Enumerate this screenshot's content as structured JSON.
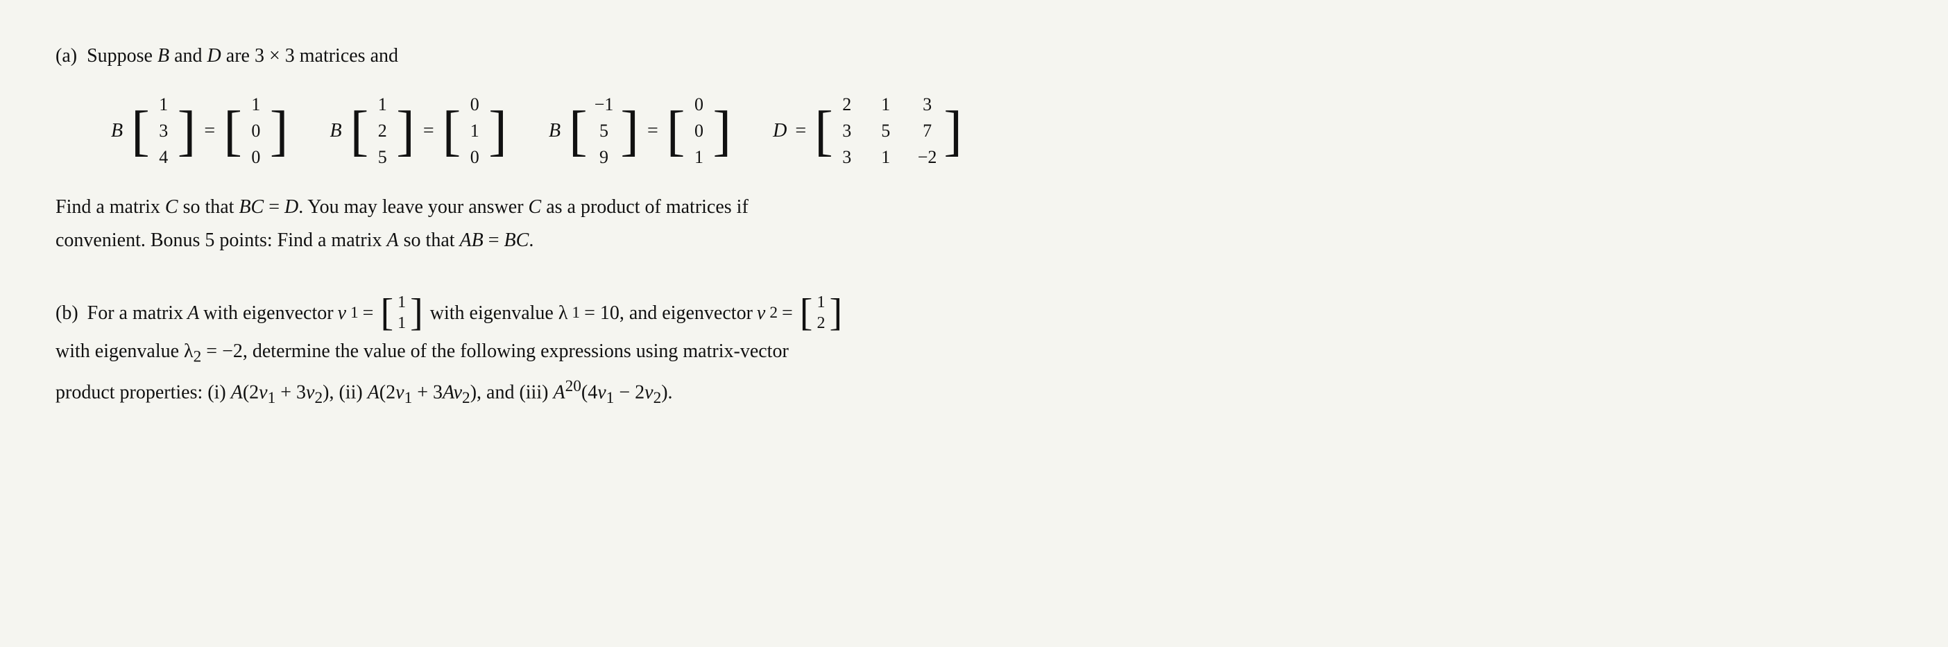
{
  "page": {
    "part_a_label": "(a)",
    "part_a_intro": "Suppose B and D are 3 × 3 matrices and",
    "matrices": [
      {
        "id": "B1",
        "lhs_label": "B",
        "lhs_vector": [
          "1",
          "3",
          "4"
        ],
        "eq": "=",
        "rhs_vector": [
          "1",
          "0",
          "0"
        ]
      },
      {
        "id": "B2",
        "lhs_label": "B",
        "lhs_vector": [
          "1",
          "2",
          "5"
        ],
        "eq": "=",
        "rhs_vector": [
          "0",
          "1",
          "0"
        ]
      },
      {
        "id": "B3",
        "lhs_label": "B",
        "lhs_vector": [
          "-1",
          "5",
          "9"
        ],
        "eq": "=",
        "rhs_vector": [
          "0",
          "0",
          "1"
        ]
      },
      {
        "id": "D",
        "lhs_label": "D",
        "eq": "=",
        "rhs_matrix": [
          [
            "2",
            "1",
            "3"
          ],
          [
            "3",
            "5",
            "7"
          ],
          [
            "3",
            "1",
            "-2"
          ]
        ]
      }
    ],
    "description_line1": "Find a matrix C so that BC = D. You may leave your answer C as a product of matrices if",
    "description_line2": "convenient. Bonus 5 points: Find a matrix A so that AB = BC.",
    "part_b_label": "(b)",
    "part_b_line1_prefix": "For a matrix A with eigenvector v",
    "part_b_v1_sub": "1",
    "part_b_v1_vector": [
      "1",
      "1"
    ],
    "part_b_eigenvalue1": "with eigenvalue λ",
    "part_b_lambda1_sub": "1",
    "part_b_lambda1_val": "= 10, and eigenvector v",
    "part_b_v2_sub": "2",
    "part_b_v2_vector": [
      "1",
      "2"
    ],
    "part_b_line2": "with eigenvalue λ₂ = −2, determine the value of the following expressions using matrix-vector",
    "part_b_line3": "product properties: (i) A(2v₁ + 3v₂), (ii) A(2v₁ + 3Av₂), and (iii) A²⁰(4v₁ − 2v₂)."
  }
}
